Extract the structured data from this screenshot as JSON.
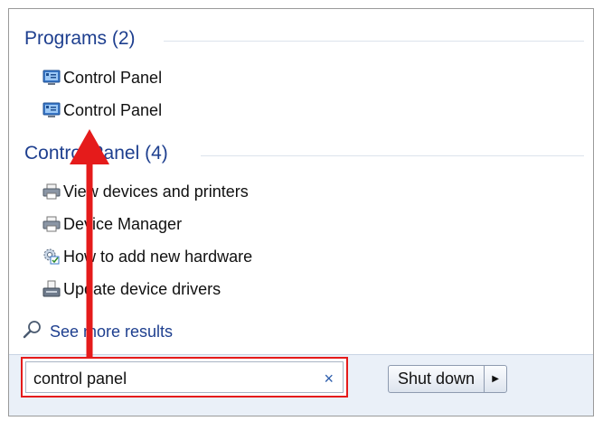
{
  "sections": {
    "programs": {
      "title": "Programs (2)",
      "items": [
        {
          "label": "Control Panel",
          "icon": "control-panel-icon"
        },
        {
          "label": "Control Panel",
          "icon": "control-panel-icon"
        }
      ]
    },
    "control_panel": {
      "title": "Control Panel (4)",
      "items": [
        {
          "label": "View devices and printers",
          "icon": "printer-icon"
        },
        {
          "label": "Device Manager",
          "icon": "device-manager-icon"
        },
        {
          "label": "How to add new hardware",
          "icon": "hardware-help-icon"
        },
        {
          "label": "Update device drivers",
          "icon": "driver-icon"
        }
      ]
    }
  },
  "see_more": {
    "label": "See more results",
    "icon": "search-icon"
  },
  "search": {
    "value": "control panel",
    "clear_icon": "close-icon",
    "clear_glyph": "×"
  },
  "shutdown": {
    "label": "Shut down",
    "arrow_glyph": "▶"
  },
  "annotation": {
    "color": "#e51b1b"
  }
}
